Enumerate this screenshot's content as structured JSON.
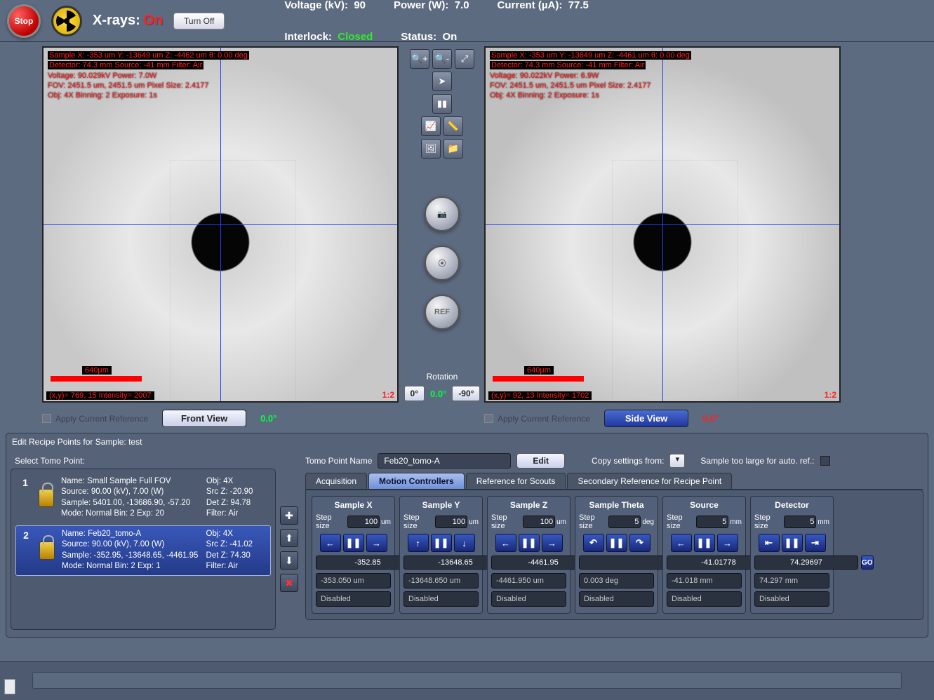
{
  "header": {
    "stop": "Stop",
    "xray_label": "X-rays:",
    "xray_state": "On",
    "turnoff": "Turn Off",
    "voltage_lbl": "Voltage (kV):",
    "voltage_val": "90",
    "power_lbl": "Power (W):",
    "power_val": "7.0",
    "current_lbl": "Current (µA):",
    "current_val": "77.5",
    "interlock_lbl": "Interlock:",
    "interlock_val": "Closed",
    "status_lbl": "Status:",
    "status_val": "On"
  },
  "left_view": {
    "line1": "Sample X:  -353 um   Y: -13649 um   Z:  -4462 um   θ: 0.00 deg",
    "line2": "Detector:  74.3 mm    Source:   -41 mm     Filter: Air",
    "line3": "Voltage:  90.029kV    Power:  7.0W",
    "line4": "FOV:  2451.5 um, 2451.5 um   Pixel Size: 2.4177",
    "line5": "Obj: 4X     Binning:  2     Exposure:  1s",
    "scale": "640µm",
    "readout": "(x,y)=    769, 15    Intensity= 2007",
    "ratio": "1:2",
    "apply_ref": "Apply Current Reference",
    "btn": "Front View",
    "angle": "0.0°"
  },
  "right_view": {
    "line1": "Sample X:  -353 um   Y: -13649 um   Z:  -4461 um   θ: 0.00 deg",
    "line2": "Detector:  74.3 mm    Source:   -41 mm     Filter: Air",
    "line3": "Voltage:  90.022kV    Power:  6.9W",
    "line4": "FOV:  2451.5 um, 2451.5 um   Pixel Size: 2.4177",
    "line5": "Obj: 4X     Binning:  2     Exposure:  1s",
    "scale": "640µm",
    "readout": "(x,y)=    92, 13    Intensity= 1702",
    "ratio": "1:2",
    "apply_ref": "Apply Current Reference",
    "btn": "Side View",
    "angle": "0.0°"
  },
  "center": {
    "ref": "REF",
    "rotation_lbl": "Rotation",
    "rot_0": "0°",
    "rot_cur": "0.0°",
    "rot_m90": "-90°"
  },
  "recipe_hdr": "Edit Recipe Points for Sample: test",
  "select_lbl": "Select Tomo Point:",
  "points": [
    {
      "idx": "1",
      "name": "Name: Small Sample Full FOV",
      "obj": "Obj: 4X",
      "source": "Source: 90.00 (kV),   7.00 (W)",
      "srcz": "Src Z: -20.90",
      "sample": "Sample: 5401.00,  -13686.90,  -57.20",
      "detz": "Det Z: 94.78",
      "mode": "Mode: Normal          Bin: 2          Exp: 20",
      "filter": "Filter: Air"
    },
    {
      "idx": "2",
      "name": "Name: Feb20_tomo-A",
      "obj": "Obj: 4X",
      "source": "Source: 90.00 (kV),   7.00 (W)",
      "srcz": "Src Z: -41.02",
      "sample": "Sample: -352.95,  -13648.65,  -4461.95",
      "detz": "Det Z: 74.30",
      "mode": "Mode: Normal          Bin: 2          Exp: 1",
      "filter": "Filter: Air"
    }
  ],
  "form": {
    "name_lbl": "Tomo Point Name",
    "name_val": "Feb20_tomo-A",
    "edit": "Edit",
    "copy_lbl": "Copy settings from:",
    "too_large": "Sample too large for auto. ref.:"
  },
  "tabs": {
    "acq": "Acquisition",
    "motion": "Motion Controllers",
    "refsc": "Reference for Scouts",
    "secref": "Secondary Reference for Recipe Point"
  },
  "motion": [
    {
      "label": "Sample X",
      "step": "100",
      "unit": "um",
      "pos": "-352.85",
      "actual": "-353.050 um",
      "state": "Disabled"
    },
    {
      "label": "Sample Y",
      "step": "100",
      "unit": "um",
      "pos": "-13648.65",
      "actual": "-13648.650 um",
      "state": "Disabled"
    },
    {
      "label": "Sample Z",
      "step": "100",
      "unit": "um",
      "pos": "-4461.95",
      "actual": "-4461.950 um",
      "state": "Disabled"
    },
    {
      "label": "Sample Theta",
      "step": "5",
      "unit": "deg",
      "pos": "",
      "actual": "0.003 deg",
      "state": "Disabled"
    },
    {
      "label": "Source",
      "step": "5",
      "unit": "mm",
      "pos": "-41.01778",
      "actual": "-41.018 mm",
      "state": "Disabled"
    },
    {
      "label": "Detector",
      "step": "5",
      "unit": "mm",
      "pos": "74.29697",
      "actual": "74.297 mm",
      "state": "Disabled"
    }
  ],
  "motion_labels": {
    "stepsize": "Step size",
    "go": "GO"
  },
  "nav_icons": {
    "x": [
      "←",
      "❚❚",
      "→"
    ],
    "y": [
      "↑",
      "❚❚",
      "↓"
    ],
    "z": [
      "←",
      "❚❚",
      "→"
    ],
    "t": [
      "↶",
      "❚❚",
      "↷"
    ],
    "s": [
      "←",
      "❚❚",
      "→"
    ],
    "d": [
      "⇤",
      "❚❚",
      "⇥"
    ]
  }
}
